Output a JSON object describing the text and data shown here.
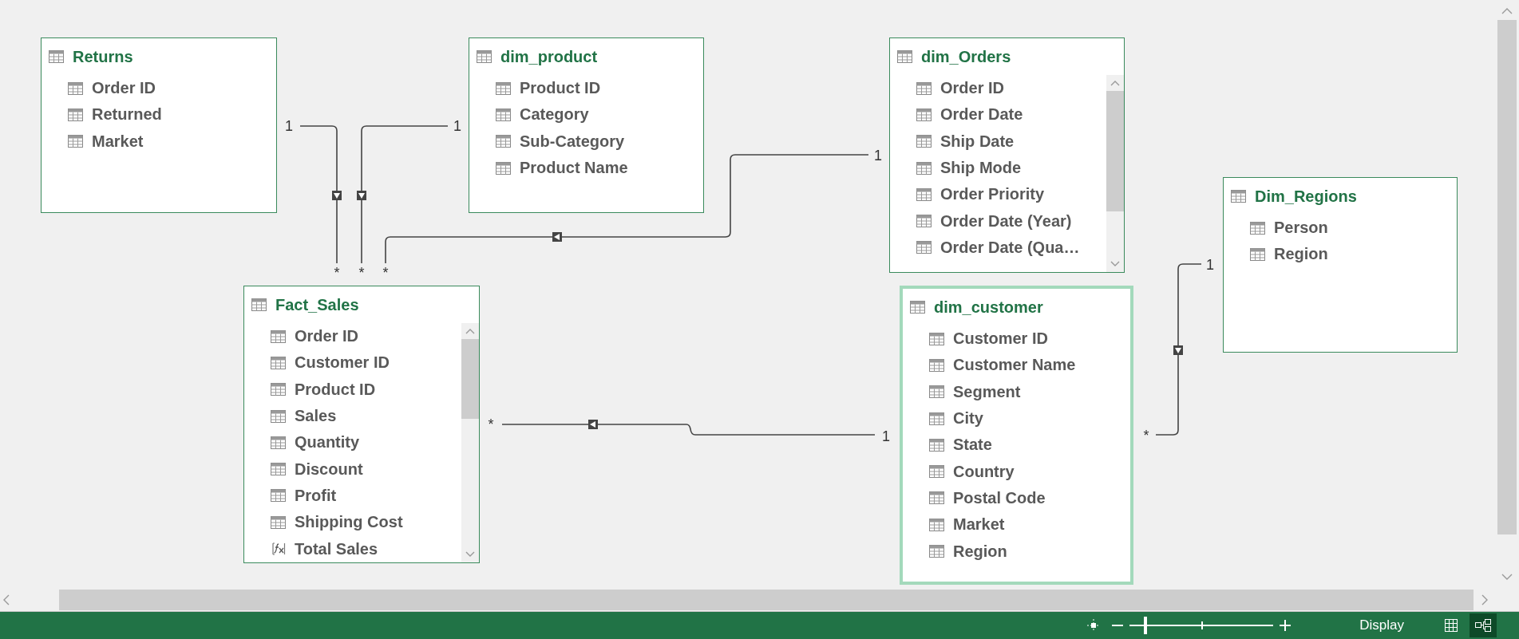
{
  "tables": [
    {
      "name": "Returns",
      "selected": false,
      "scrollable": false,
      "fields": [
        {
          "name": "Order ID",
          "kind": "column"
        },
        {
          "name": "Returned",
          "kind": "column"
        },
        {
          "name": "Market",
          "kind": "column"
        }
      ]
    },
    {
      "name": "dim_product",
      "selected": false,
      "scrollable": false,
      "fields": [
        {
          "name": "Product ID",
          "kind": "column"
        },
        {
          "name": "Category",
          "kind": "column"
        },
        {
          "name": "Sub-Category",
          "kind": "column"
        },
        {
          "name": "Product Name",
          "kind": "column"
        }
      ]
    },
    {
      "name": "dim_Orders",
      "selected": false,
      "scrollable": true,
      "fields": [
        {
          "name": "Order ID",
          "kind": "column"
        },
        {
          "name": "Order Date",
          "kind": "column"
        },
        {
          "name": "Ship Date",
          "kind": "column"
        },
        {
          "name": "Ship Mode",
          "kind": "column"
        },
        {
          "name": "Order Priority",
          "kind": "column"
        },
        {
          "name": "Order Date (Year)",
          "kind": "column"
        },
        {
          "name": "Order Date (Qua…",
          "kind": "column"
        }
      ]
    },
    {
      "name": "Dim_Regions",
      "selected": false,
      "scrollable": false,
      "fields": [
        {
          "name": "Person",
          "kind": "column"
        },
        {
          "name": "Region",
          "kind": "column"
        }
      ]
    },
    {
      "name": "Fact_Sales",
      "selected": false,
      "scrollable": true,
      "fields": [
        {
          "name": "Order ID",
          "kind": "column"
        },
        {
          "name": "Customer ID",
          "kind": "column"
        },
        {
          "name": "Product ID",
          "kind": "column"
        },
        {
          "name": "Sales",
          "kind": "column"
        },
        {
          "name": "Quantity",
          "kind": "column"
        },
        {
          "name": "Discount",
          "kind": "column"
        },
        {
          "name": "Profit",
          "kind": "column"
        },
        {
          "name": "Shipping Cost",
          "kind": "column"
        },
        {
          "name": "Total Sales",
          "kind": "measure"
        }
      ]
    },
    {
      "name": "dim_customer",
      "selected": true,
      "scrollable": false,
      "fields": [
        {
          "name": "Customer ID",
          "kind": "column"
        },
        {
          "name": "Customer Name",
          "kind": "column"
        },
        {
          "name": "Segment",
          "kind": "column"
        },
        {
          "name": "City",
          "kind": "column"
        },
        {
          "name": "State",
          "kind": "column"
        },
        {
          "name": "Country",
          "kind": "column"
        },
        {
          "name": "Postal Code",
          "kind": "column"
        },
        {
          "name": "Market",
          "kind": "column"
        },
        {
          "name": "Region",
          "kind": "column"
        }
      ]
    }
  ],
  "relationships": [
    {
      "one_label": "1",
      "many_label": "*"
    },
    {
      "one_label": "1",
      "many_label": "*"
    },
    {
      "one_label": "1",
      "many_label": "*"
    },
    {
      "many_label": "*",
      "one_label": "1"
    },
    {
      "one_label": "1",
      "many_label": "*"
    }
  ],
  "status_bar": {
    "zoom": {
      "level": 0.11
    },
    "display_label": "Display",
    "views": [
      {
        "kind": "grid",
        "selected": false
      },
      {
        "kind": "diagram",
        "selected": true
      }
    ]
  }
}
